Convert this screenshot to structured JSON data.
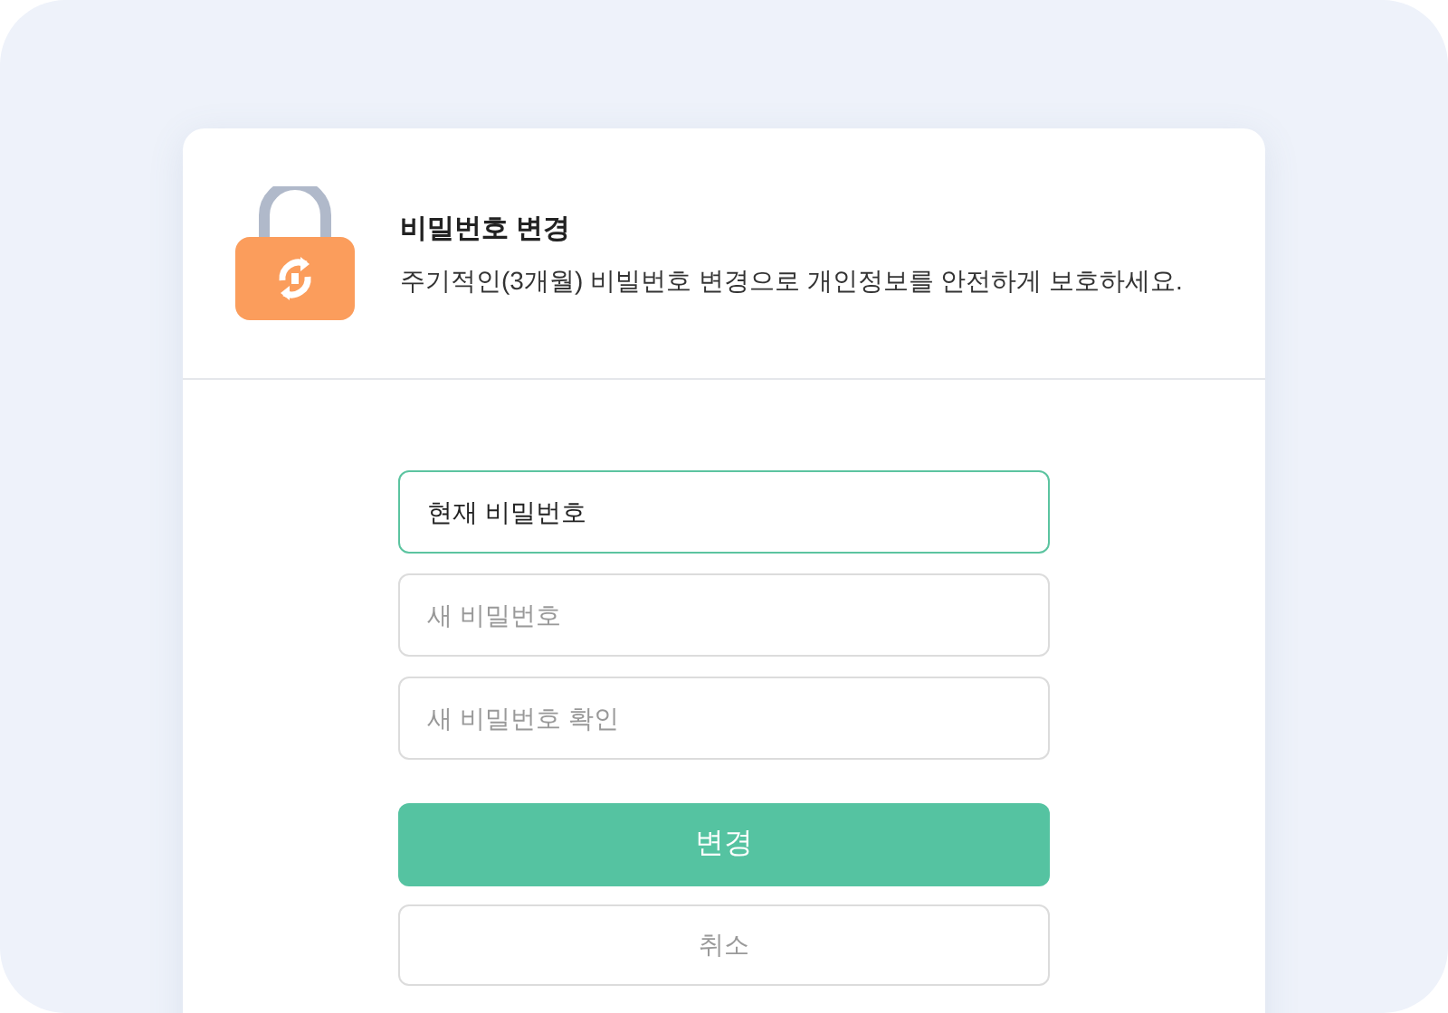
{
  "header": {
    "title": "비밀번호 변경",
    "description": "주기적인(3개월) 비빌번호 변경으로 개인정보를 안전하게 보호하세요."
  },
  "fields": [
    {
      "placeholder": "현재 비밀번호",
      "focused": true
    },
    {
      "placeholder": "새 비밀번호",
      "focused": false
    },
    {
      "placeholder": "새 비밀번호 확인",
      "focused": false
    }
  ],
  "buttons": [
    {
      "label": "변경",
      "kind": "primary"
    },
    {
      "label": "취소",
      "kind": "secondary"
    }
  ]
}
